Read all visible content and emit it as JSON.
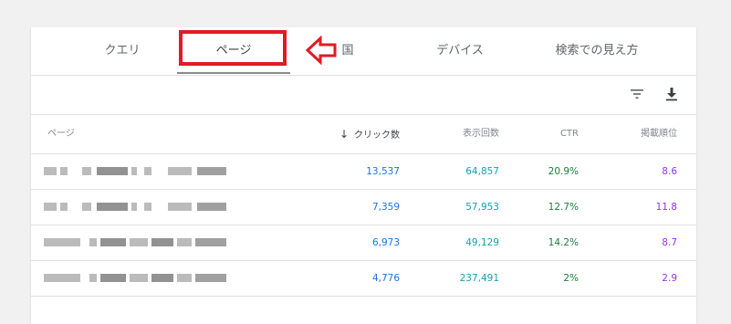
{
  "tabs": [
    {
      "label": "クエリ",
      "active": false
    },
    {
      "label": "ページ",
      "active": true
    },
    {
      "label": "国",
      "active": false
    },
    {
      "label": "デバイス",
      "active": false
    },
    {
      "label": "検索での見え方",
      "active": false
    }
  ],
  "toolbar": {
    "icons": [
      "filter-icon",
      "download-icon"
    ]
  },
  "table": {
    "columns": {
      "page": "ページ",
      "clicks": "クリック数",
      "impressions": "表示回数",
      "ctr": "CTR",
      "position": "掲載順位"
    },
    "sort_column": "clicks",
    "sort_direction": "descending",
    "rows": [
      {
        "clicks": "13,537",
        "impressions": "64,857",
        "ctr": "20.9%",
        "position": "8.6"
      },
      {
        "clicks": "7,359",
        "impressions": "57,953",
        "ctr": "12.7%",
        "position": "11.8"
      },
      {
        "clicks": "6,973",
        "impressions": "49,129",
        "ctr": "14.2%",
        "position": "8.7"
      },
      {
        "clicks": "4,776",
        "impressions": "237,491",
        "ctr": "2%",
        "position": "2.9"
      }
    ]
  },
  "colors": {
    "clicks": "#1a73e8",
    "impressions": "#12a4af",
    "ctr": "#188038",
    "position": "#9334e6",
    "highlight": "#e01b24"
  }
}
